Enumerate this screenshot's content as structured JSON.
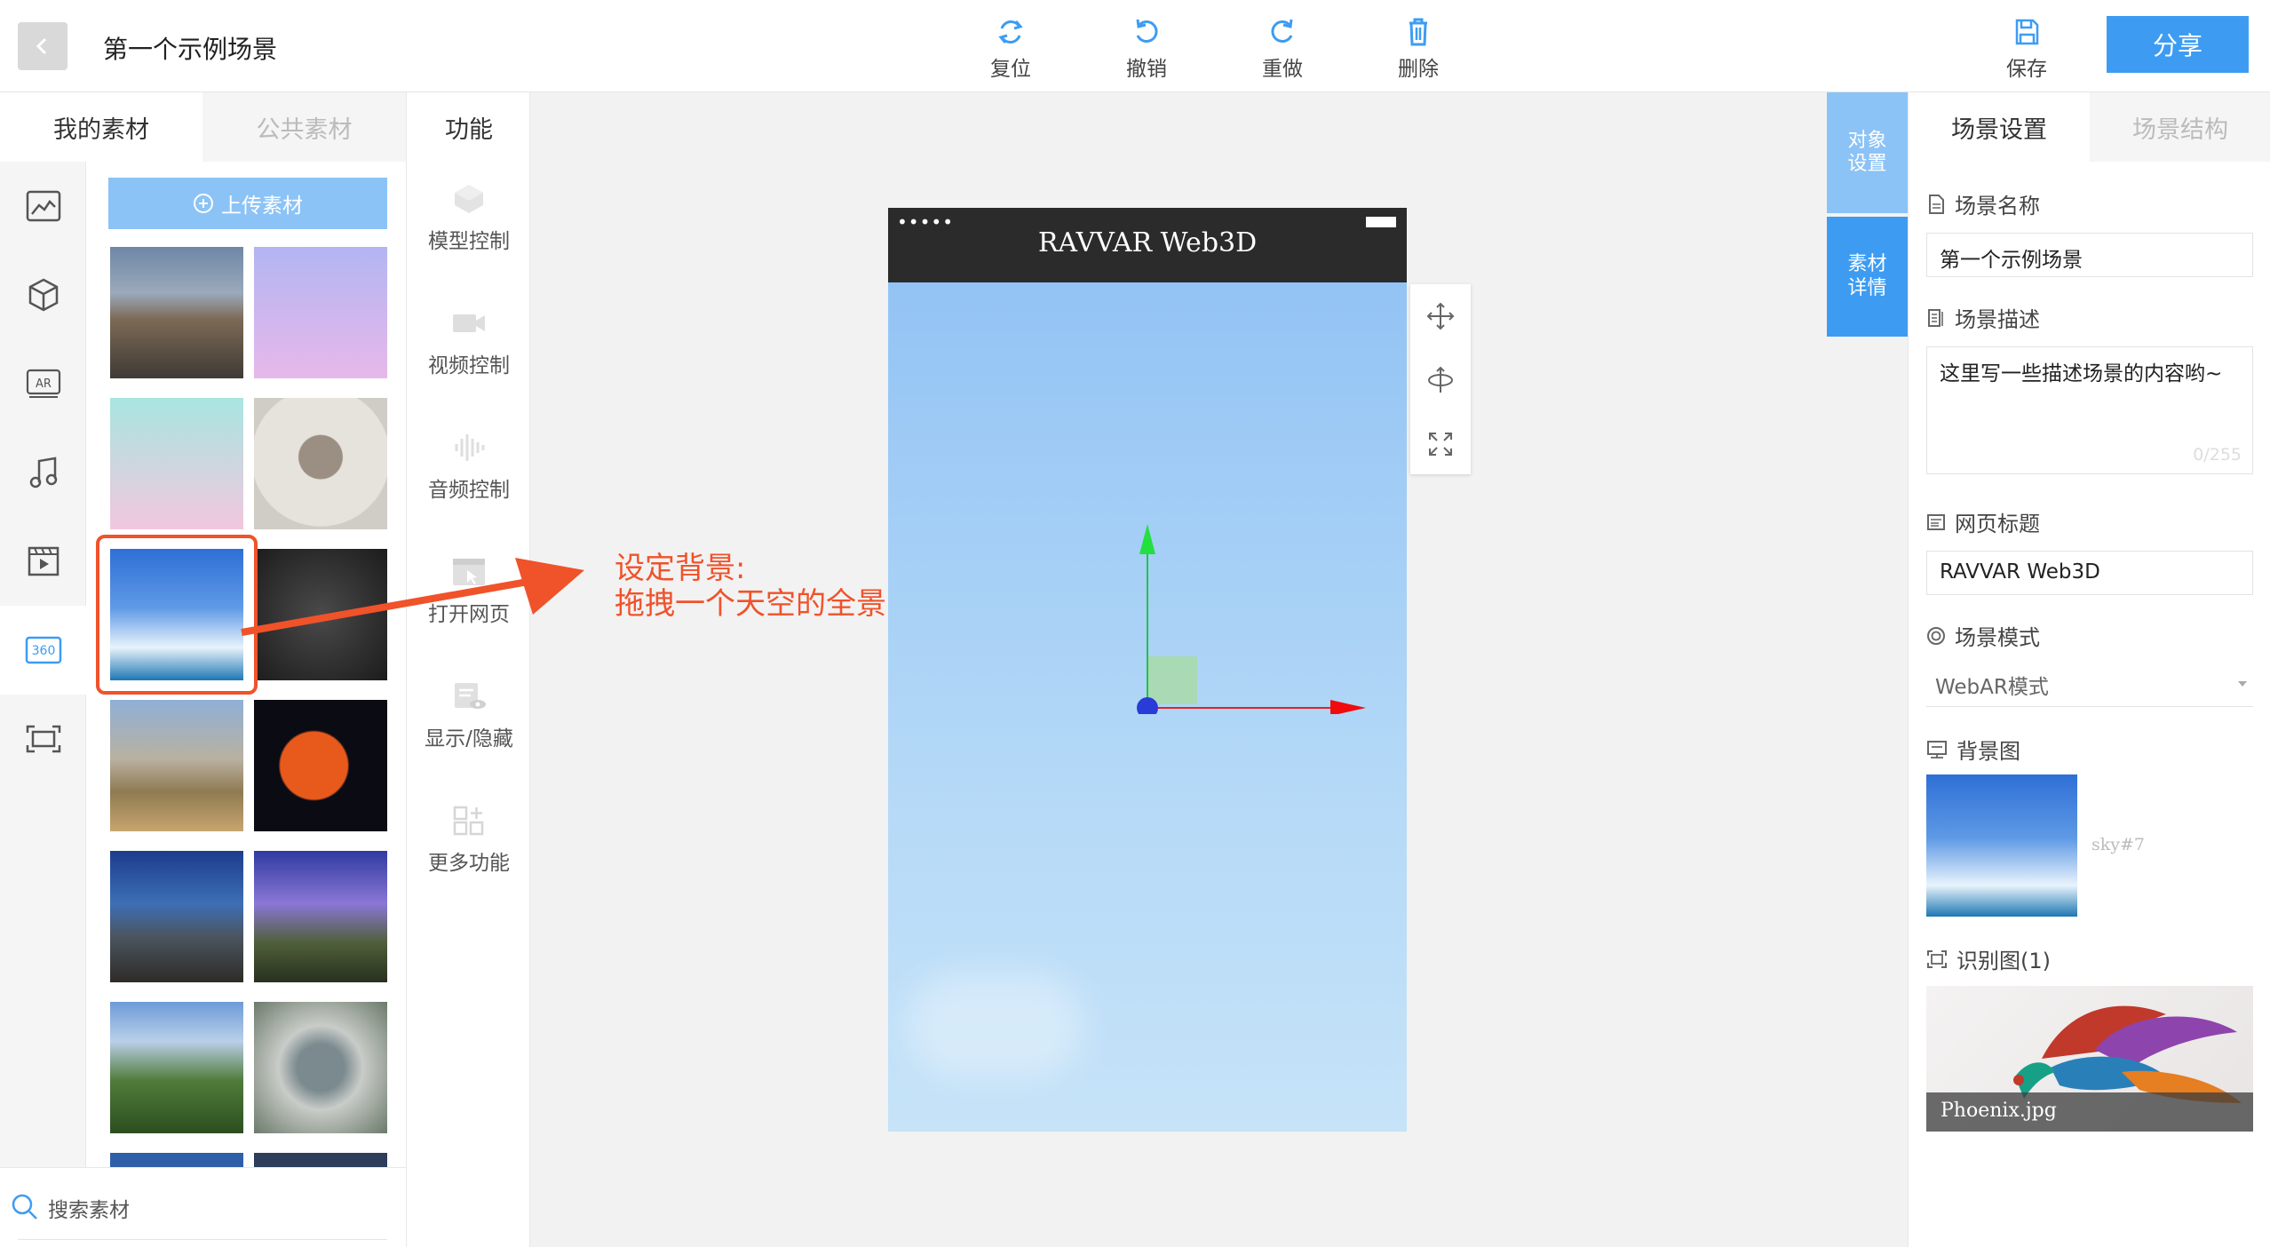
{
  "header": {
    "title": "第一个示例场景",
    "tools": [
      "复位",
      "撤销",
      "重做",
      "删除"
    ],
    "save_label": "保存",
    "share_label": "分享"
  },
  "left": {
    "tabs": [
      "我的素材",
      "公共素材"
    ],
    "upload_label": "上传素材",
    "search_placeholder": "搜索素材",
    "rail_icons": [
      "image-icon",
      "cube-icon",
      "ar-icon",
      "music-icon",
      "video-icon",
      "360-icon",
      "scan-icon"
    ]
  },
  "functions": {
    "title": "功能",
    "items": [
      "模型控制",
      "视频控制",
      "音频控制",
      "打开网页",
      "显示/隐藏",
      "更多功能"
    ]
  },
  "phone": {
    "title": "RAVVAR Web3D",
    "signal": "•••••"
  },
  "annotation": {
    "line1": "设定背景:",
    "line2": "拖拽一个天空的全景图"
  },
  "right": {
    "side_tabs": [
      "对象设置",
      "素材详情"
    ],
    "tabs": [
      "场景设置",
      "场景结构"
    ],
    "name_label": "场景名称",
    "name_value": "第一个示例场景",
    "desc_label": "场景描述",
    "desc_value": "这里写一些描述场景的内容哟~",
    "desc_count": "0/255",
    "page_title_label": "网页标题",
    "page_title_value": "RAVVAR Web3D",
    "mode_label": "场景模式",
    "mode_value": "WebAR模式",
    "bg_label": "背景图",
    "bg_name": "sky#7",
    "recog_label": "识别图(1)",
    "recog_name": "Phoenix.jpg"
  },
  "colors": {
    "accent": "#3d9cf2",
    "annotation": "#f0522a"
  }
}
